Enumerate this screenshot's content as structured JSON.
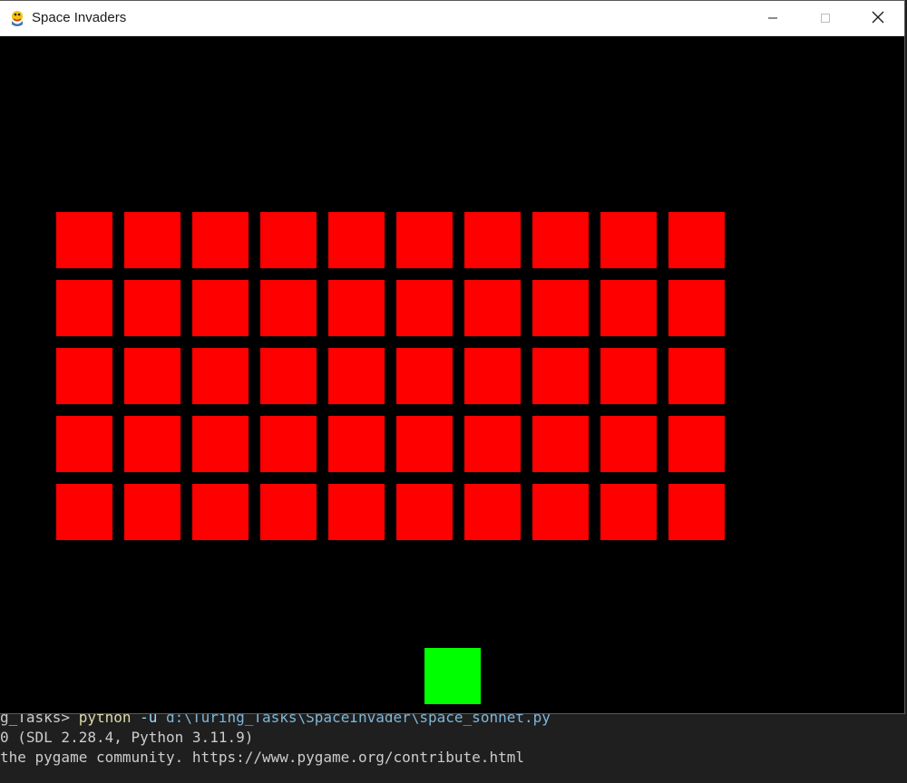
{
  "window": {
    "title": "Space Invaders",
    "icon": "python-snake-icon"
  },
  "controls": {
    "minimize_icon": "minimize-icon",
    "maximize_icon": "maximize-icon",
    "close_icon": "close-icon"
  },
  "game": {
    "background_color": "#000000",
    "invader_color": "#ff0000",
    "player_color": "#00ff00",
    "invader_rows": 5,
    "invader_cols": 10
  },
  "terminal": {
    "line1_prompt": "g_Tasks> ",
    "line1_cmd": "python",
    "line1_arg": " -u ",
    "line1_path": "d:\\Turing_Tasks\\SpaceInvader\\space_sonnet.py",
    "line2": "0 (SDL 2.28.4, Python 3.11.9)",
    "line3": "the pygame community. https://www.pygame.org/contribute.html"
  }
}
